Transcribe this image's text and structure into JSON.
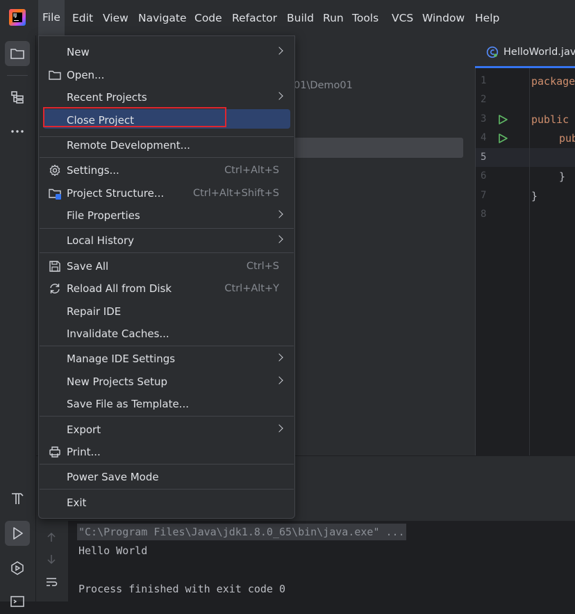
{
  "menubar": {
    "items": [
      "File",
      "Edit",
      "View",
      "Navigate",
      "Code",
      "Refactor",
      "Build",
      "Run",
      "Tools",
      "VCS",
      "Window",
      "Help"
    ]
  },
  "project": {
    "path_fragment": "01\\Demo01"
  },
  "editor": {
    "tab_label": "HelloWorld.jav",
    "line_numbers": [
      "1",
      "2",
      "3",
      "4",
      "5",
      "6",
      "7",
      "8"
    ],
    "code": {
      "l1": "package",
      "l3": "public",
      "l4": "pub",
      "l6": "}",
      "l7": "}"
    }
  },
  "file_menu": {
    "items": [
      {
        "label": "New",
        "shortcut": "",
        "submenu": true,
        "icon": ""
      },
      {
        "label": "Open...",
        "shortcut": "",
        "submenu": false,
        "icon": "folder-icon"
      },
      {
        "label": "Recent Projects",
        "shortcut": "",
        "submenu": true,
        "icon": ""
      },
      {
        "label": "Close Project",
        "shortcut": "",
        "submenu": false,
        "icon": "",
        "highlighted": true
      },
      {
        "label": "Remote Development...",
        "shortcut": "",
        "submenu": false,
        "icon": ""
      },
      {
        "label": "Settings...",
        "shortcut": "Ctrl+Alt+S",
        "submenu": false,
        "icon": "gear-icon"
      },
      {
        "label": "Project Structure...",
        "shortcut": "Ctrl+Alt+Shift+S",
        "submenu": false,
        "icon": "project-structure-icon"
      },
      {
        "label": "File Properties",
        "shortcut": "",
        "submenu": true,
        "icon": ""
      },
      {
        "label": "Local History",
        "shortcut": "",
        "submenu": true,
        "icon": ""
      },
      {
        "label": "Save All",
        "shortcut": "Ctrl+S",
        "submenu": false,
        "icon": "save-icon"
      },
      {
        "label": "Reload All from Disk",
        "shortcut": "Ctrl+Alt+Y",
        "submenu": false,
        "icon": "reload-icon"
      },
      {
        "label": "Repair IDE",
        "shortcut": "",
        "submenu": false,
        "icon": ""
      },
      {
        "label": "Invalidate Caches...",
        "shortcut": "",
        "submenu": false,
        "icon": ""
      },
      {
        "label": "Manage IDE Settings",
        "shortcut": "",
        "submenu": true,
        "icon": ""
      },
      {
        "label": "New Projects Setup",
        "shortcut": "",
        "submenu": true,
        "icon": ""
      },
      {
        "label": "Save File as Template...",
        "shortcut": "",
        "submenu": false,
        "icon": ""
      },
      {
        "label": "Export",
        "shortcut": "",
        "submenu": true,
        "icon": ""
      },
      {
        "label": "Print...",
        "shortcut": "",
        "submenu": false,
        "icon": "printer-icon"
      },
      {
        "label": "Power Save Mode",
        "shortcut": "",
        "submenu": false,
        "icon": ""
      },
      {
        "label": "Exit",
        "shortcut": "",
        "submenu": false,
        "icon": ""
      }
    ]
  },
  "console": {
    "command": "\"C:\\Program Files\\Java\\jdk1.8.0_65\\bin\\java.exe\" ...",
    "output": "Hello World",
    "exit_message": "Process finished with exit code 0"
  },
  "colors": {
    "menu_bg": "#2b2d30",
    "highlight": "#2e436e",
    "red_annotation": "#e0262e",
    "accent": "#3574f0"
  }
}
